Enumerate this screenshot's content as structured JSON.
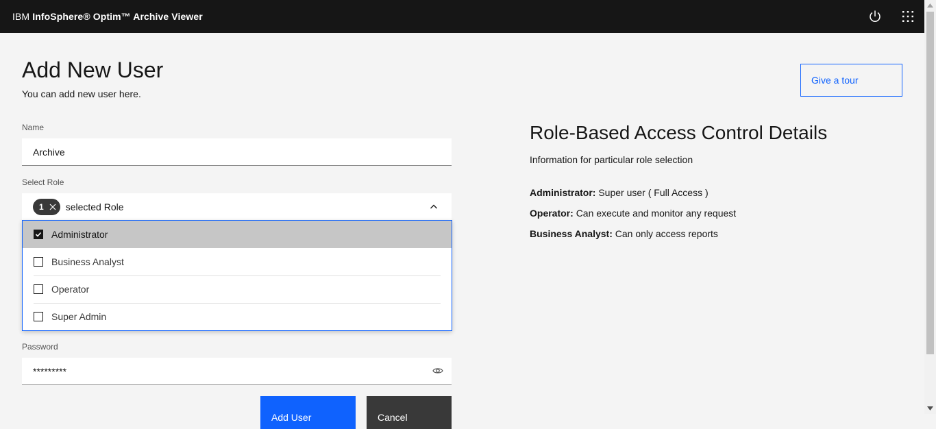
{
  "header": {
    "brand_prefix": "IBM",
    "brand_name": "InfoSphere® Optim™ Archive Viewer",
    "icons": [
      "power-icon",
      "app-switcher-icon"
    ]
  },
  "page": {
    "title": "Add New User",
    "subtitle": "You can add new user here.",
    "tour_button": "Give a tour"
  },
  "form": {
    "name_label": "Name",
    "name_value": "Archive",
    "role_label": "Select Role",
    "selected_count": "1",
    "role_placeholder": "selected Role",
    "role_options": [
      {
        "label": "Administrator",
        "checked": true
      },
      {
        "label": "Business Analyst",
        "checked": false
      },
      {
        "label": "Operator",
        "checked": false
      },
      {
        "label": "Super Admin",
        "checked": false
      }
    ],
    "password_label": "Password",
    "password_value": "*********",
    "add_button": "Add User",
    "cancel_button": "Cancel"
  },
  "rbac": {
    "title": "Role-Based Access Control Details",
    "subtitle": "Information for particular role selection",
    "items": [
      {
        "role": "Administrator:",
        "desc": "Super user ( Full Access )"
      },
      {
        "role": "Operator:",
        "desc": "Can execute and monitor any request"
      },
      {
        "role": "Business Analyst:",
        "desc": "Can only access reports"
      }
    ]
  },
  "colors": {
    "header_bg": "#161616",
    "page_bg": "#f4f4f4",
    "accent": "#0f62fe",
    "secondary_button": "#393939"
  }
}
